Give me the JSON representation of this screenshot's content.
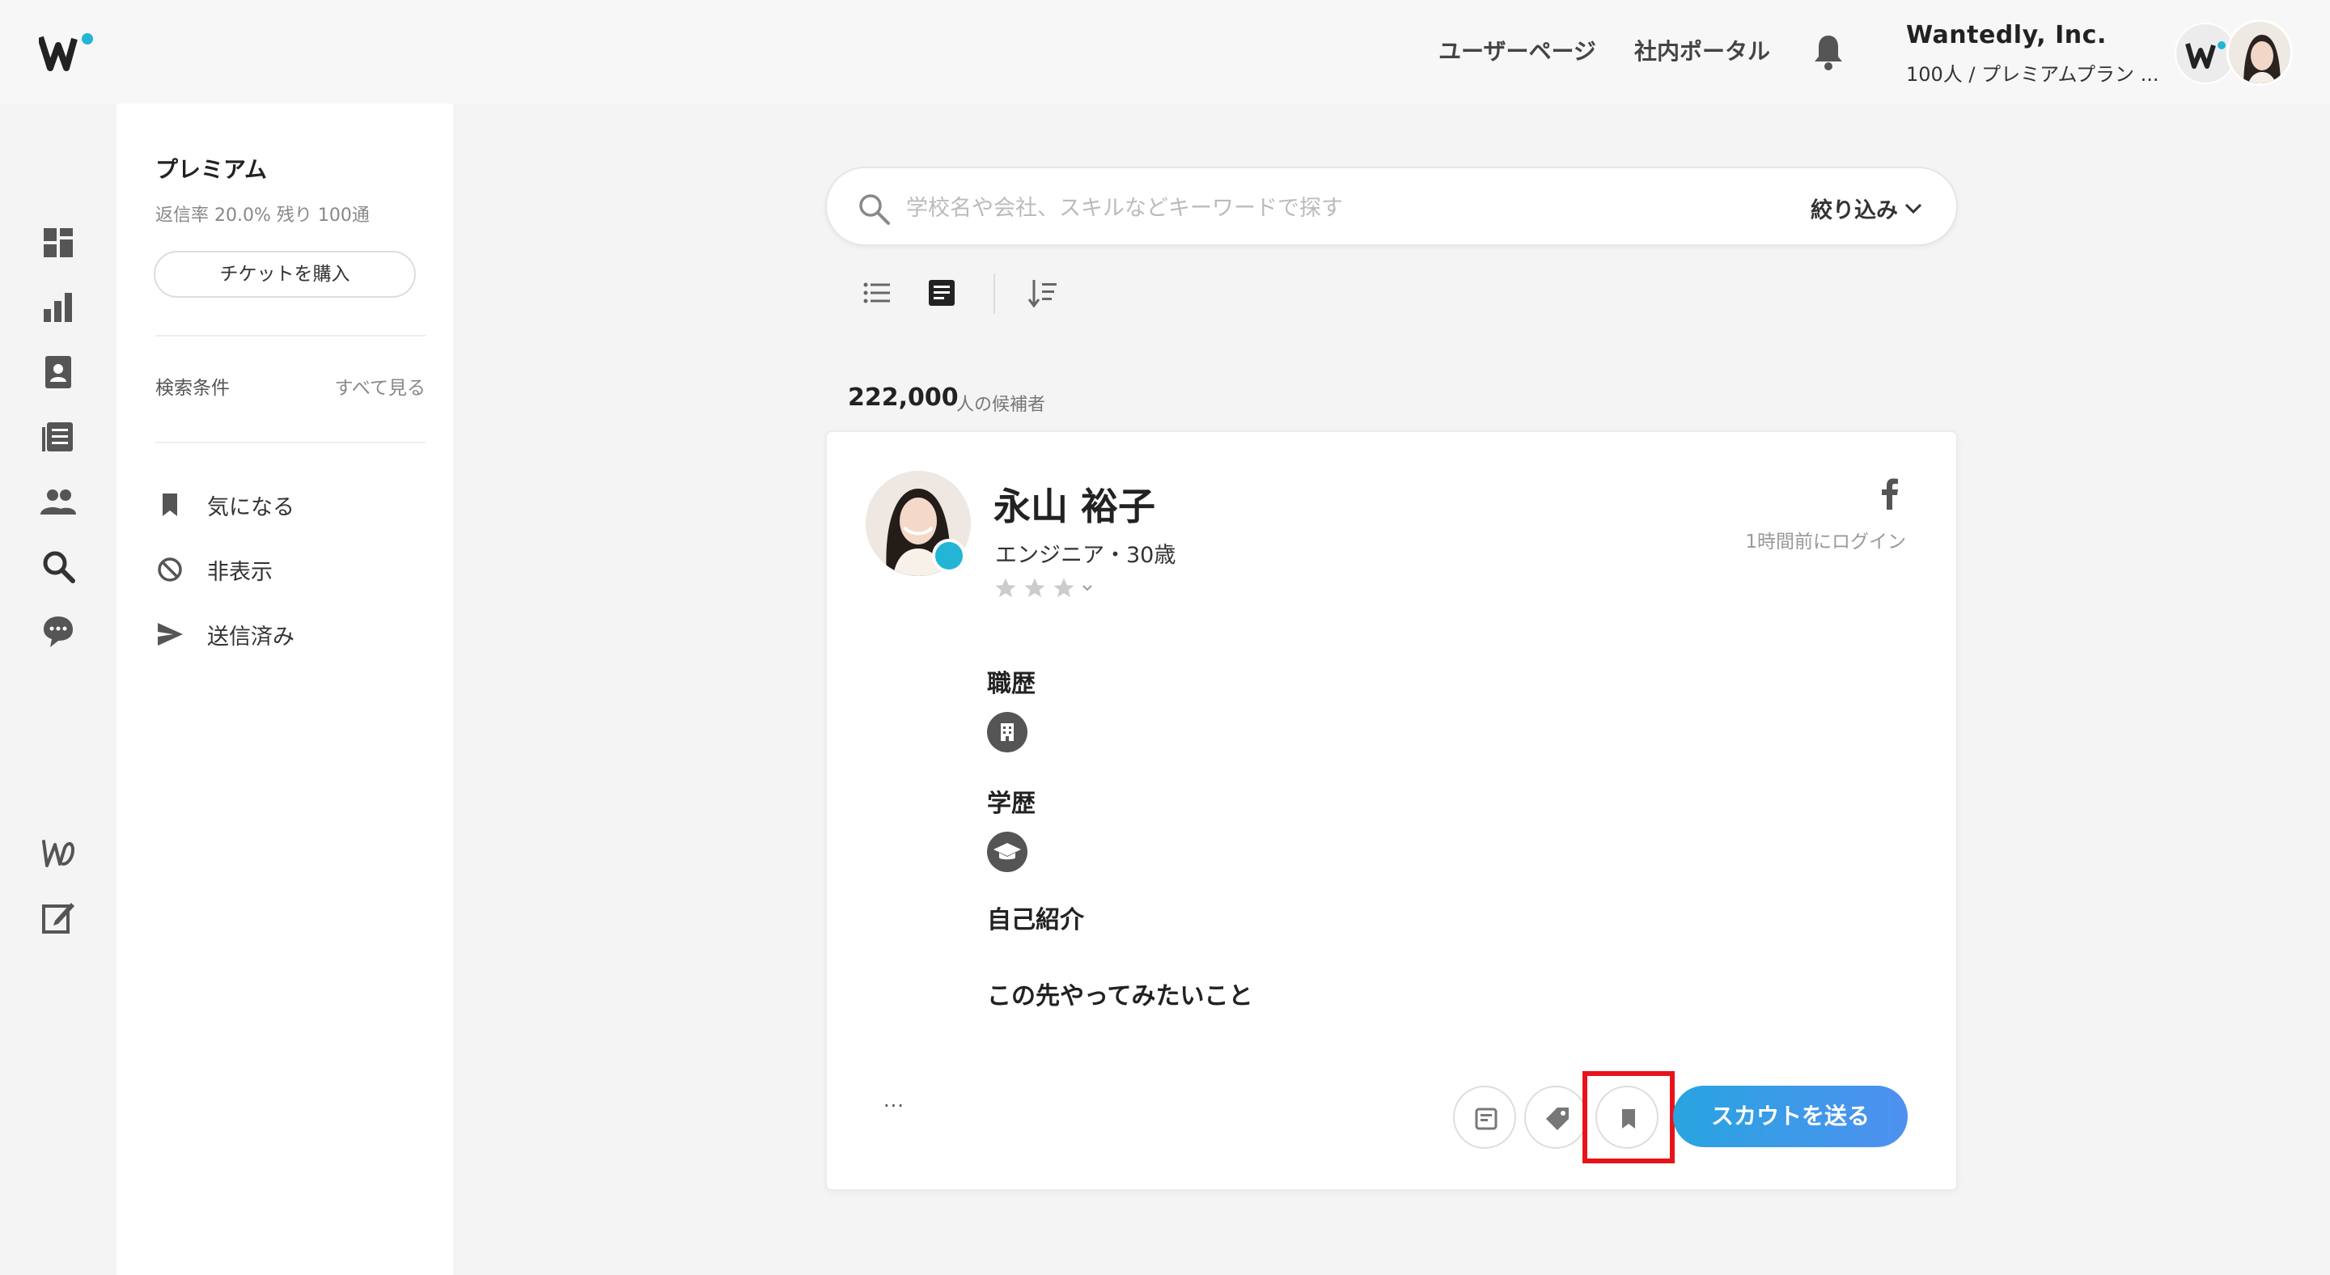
{
  "header": {
    "user_page_link": "ユーザーページ",
    "portal_link": "社内ポータル",
    "company_name": "Wantedly, Inc.",
    "company_plan": "100人 / プレミアムプラン ..."
  },
  "rail": {
    "icons": [
      "dashboard-icon",
      "analytics-icon",
      "profile-icon",
      "articles-icon",
      "people-icon",
      "search-icon",
      "chat-icon",
      "wantedly-icon",
      "edit-icon"
    ]
  },
  "sidebar": {
    "plan_title": "プレミアム",
    "plan_stats": "返信率 20.0%  残り 100通",
    "buy_ticket": "チケットを購入",
    "conditions_label": "検索条件",
    "conditions_all": "すべて見る",
    "items": [
      {
        "label": "気になる",
        "icon": "bookmark-icon"
      },
      {
        "label": "非表示",
        "icon": "hidden-icon"
      },
      {
        "label": "送信済み",
        "icon": "sent-icon"
      }
    ]
  },
  "search": {
    "placeholder": "学校名や会社、スキルなどキーワードで探す",
    "value": "",
    "filter_label": "絞り込み"
  },
  "results": {
    "count": "222,000",
    "count_suffix": "人の候補者"
  },
  "candidate": {
    "name": "永山 裕子",
    "subtitle": "エンジニア・30歳",
    "rating": 0,
    "last_login": "1時間前にログイン",
    "sections": {
      "career": "職歴",
      "education": "学歴",
      "intro": "自己紹介",
      "wants": "この先やってみたいこと"
    },
    "more_label": "...",
    "scout_button": "スカウトを送る"
  },
  "colors": {
    "accent": "#22b5d6",
    "highlight": "#e8131a",
    "scout_gradient_start": "#28a4e0",
    "scout_gradient_end": "#4f90f0"
  }
}
